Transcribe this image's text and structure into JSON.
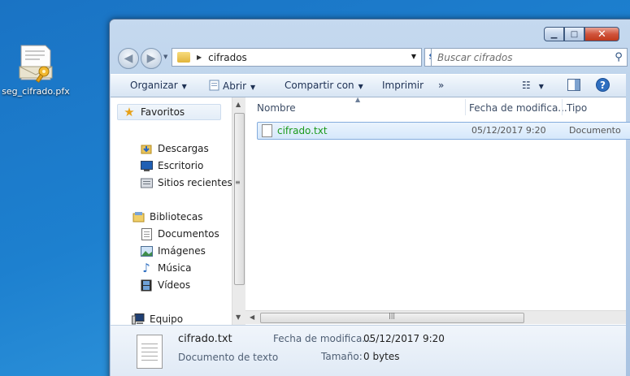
{
  "desktop": {
    "icon_label": "seg_cifrado.pfx",
    "icon_name": "certificate-file-icon"
  },
  "window": {
    "caption": {
      "minimize_glyph": "▁",
      "maximize_glyph": "□",
      "close_glyph": "✕"
    },
    "address": {
      "path": "cifrados"
    },
    "search": {
      "placeholder": "Buscar cifrados"
    },
    "toolbar": {
      "organize": "Organizar",
      "open": "Abrir",
      "share": "Compartir con",
      "print": "Imprimir",
      "more": "»"
    },
    "nav_pane": {
      "favorites": "Favoritos",
      "downloads": "Descargas",
      "desktop": "Escritorio",
      "recent": "Sitios recientes",
      "libraries": "Bibliotecas",
      "documents": "Documentos",
      "images": "Imágenes",
      "music": "Música",
      "videos": "Vídeos",
      "computer": "Equipo"
    },
    "columns": {
      "name": "Nombre",
      "date": "Fecha de modifica...",
      "type": "Tipo"
    },
    "files": [
      {
        "name": "cifrado.txt",
        "date": "05/12/2017 9:20",
        "type": "Documento"
      }
    ],
    "details": {
      "name": "cifrado.txt",
      "type": "Documento de texto",
      "date_label": "Fecha de modifica...",
      "date_value": "05/12/2017 9:20",
      "size_label": "Tamaño:",
      "size_value": "0 bytes"
    }
  },
  "colors": {
    "desktop_bg": "#1d80cf",
    "compressed_filename": "#1b9a1b",
    "close_button": "#c0391c"
  }
}
